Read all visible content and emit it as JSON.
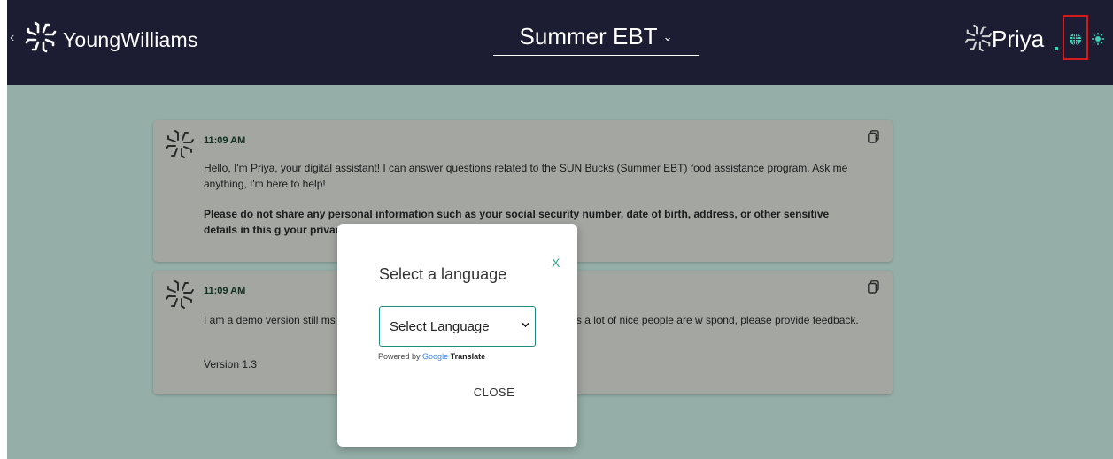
{
  "header": {
    "brand": "YoungWilliams",
    "program": "Summer EBT",
    "assistant_name": "Priya"
  },
  "messages": [
    {
      "time": "11:09 AM",
      "paragraphs": [
        "Hello, I'm Priya, your digital assistant! I can answer questions related to the SUN Bucks (Summer EBT) food assistance program. Ask me anything, I'm here to help!",
        "Please do not share any personal information such as your social security number, date of birth, address, or other sensitive details in this g your privacy is our top priority!"
      ]
    },
    {
      "time": "11:09 AM",
      "paragraphs": [
        "I am a demo version still ms with answers or functionalities. Please be patient as a lot of nice people are w spond, please provide feedback.",
        "Version 1.3"
      ]
    }
  ],
  "language_modal": {
    "title": "Select a language",
    "close_x": "X",
    "select_value": "Select Language",
    "powered_by": "Powered by",
    "google": "Google",
    "translate": "Translate",
    "close_label": "CLOSE"
  },
  "colors": {
    "topbar": "#1c1d33",
    "backdrop": "#95aea7",
    "accent": "#3aa596",
    "highlight": "#d31b1b"
  },
  "icons": [
    "back-chevron-icon",
    "youngwilliams-logo-icon",
    "chevron-down-icon",
    "priya-logo-icon",
    "globe-icon",
    "sun-icon",
    "bot-avatar-icon",
    "copy-icon"
  ]
}
